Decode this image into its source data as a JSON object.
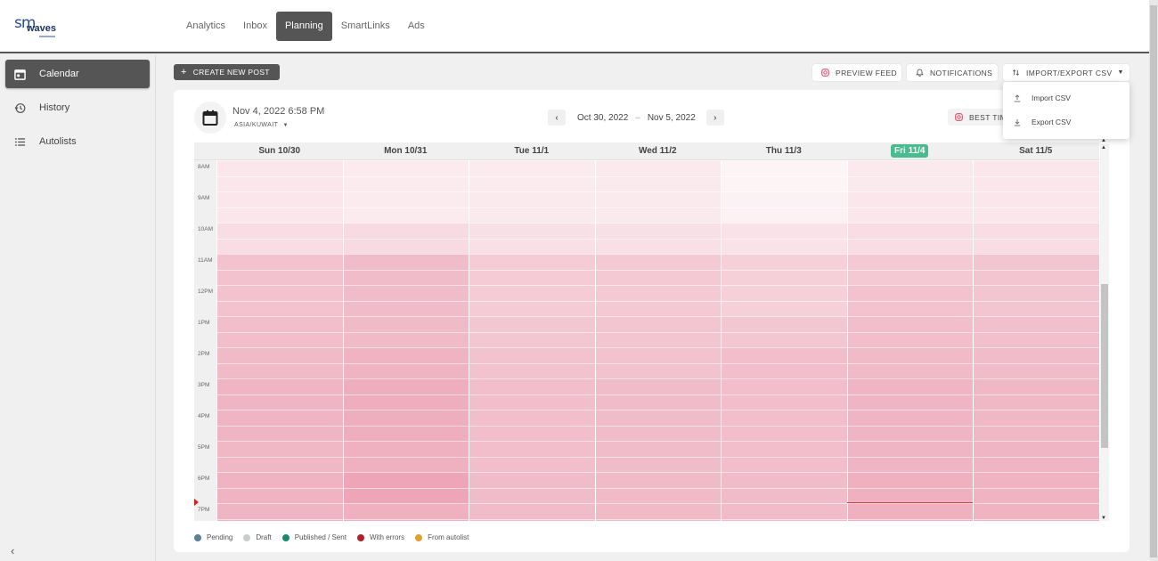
{
  "app": {
    "logo_top": "sm",
    "logo_bottom": "waves"
  },
  "nav": {
    "items": [
      "Analytics",
      "Inbox",
      "Planning",
      "SmartLinks",
      "Ads"
    ],
    "active": "Planning"
  },
  "sidebar": {
    "items": [
      {
        "label": "Calendar",
        "icon": "calendar-icon",
        "active": true
      },
      {
        "label": "History",
        "icon": "history-icon",
        "active": false
      },
      {
        "label": "Autolists",
        "icon": "list-icon",
        "active": false
      }
    ],
    "collapse": "‹"
  },
  "toolbar": {
    "create_label": "CREATE NEW POST",
    "preview_label": "PREVIEW FEED",
    "notifications_label": "NOTIFICATIONS",
    "import_export_label": "IMPORT/EXPORT CSV"
  },
  "dropdown": {
    "import_label": "Import CSV",
    "export_label": "Export CSV"
  },
  "calendar": {
    "current_datetime": "Nov 4, 2022 6:58 PM",
    "timezone": "ASIA/KUWAIT",
    "range_start": "Oct 30, 2022",
    "range_sep": "–",
    "range_end": "Nov 5, 2022",
    "best_times_label": "BEST TIMES",
    "days": [
      "Sun 10/30",
      "Mon 10/31",
      "Tue 11/1",
      "Wed 11/2",
      "Thu 11/3",
      "Fri 11/4",
      "Sat 11/5"
    ],
    "today_index": 5,
    "hours": [
      "8AM",
      "9AM",
      "10AM",
      "11AM",
      "12PM",
      "1PM",
      "2PM",
      "3PM",
      "4PM",
      "5PM",
      "6PM",
      "7PM"
    ],
    "heat": [
      [
        0.22,
        0.22,
        0.3,
        0.55,
        0.55,
        0.58,
        0.62,
        0.66,
        0.66,
        0.64,
        0.68,
        0.66
      ],
      [
        0.18,
        0.18,
        0.32,
        0.6,
        0.6,
        0.62,
        0.68,
        0.72,
        0.72,
        0.7,
        0.8,
        0.7
      ],
      [
        0.18,
        0.2,
        0.28,
        0.45,
        0.45,
        0.5,
        0.55,
        0.58,
        0.58,
        0.58,
        0.6,
        0.6
      ],
      [
        0.2,
        0.2,
        0.28,
        0.48,
        0.48,
        0.52,
        0.55,
        0.6,
        0.6,
        0.6,
        0.62,
        0.62
      ],
      [
        0.1,
        0.12,
        0.25,
        0.42,
        0.42,
        0.5,
        0.58,
        0.58,
        0.58,
        0.58,
        0.6,
        0.6
      ],
      [
        0.2,
        0.22,
        0.3,
        0.48,
        0.55,
        0.58,
        0.62,
        0.66,
        0.66,
        0.66,
        0.7,
        0.7
      ],
      [
        0.22,
        0.22,
        0.3,
        0.52,
        0.52,
        0.56,
        0.6,
        0.64,
        0.64,
        0.66,
        0.68,
        0.68
      ]
    ],
    "now_fraction_in_hour": 0.97
  },
  "legend": [
    {
      "label": "Pending",
      "color": "#5b7f95"
    },
    {
      "label": "Draft",
      "color": "#c9cdd1"
    },
    {
      "label": "Published / Sent",
      "color": "#1a8a6e"
    },
    {
      "label": "With errors",
      "color": "#b3202a"
    },
    {
      "label": "From autolist",
      "color": "#e0a02a"
    }
  ],
  "colors": {
    "accent": "#555555",
    "today": "#4aba8f",
    "heat": "#e88fa5"
  }
}
